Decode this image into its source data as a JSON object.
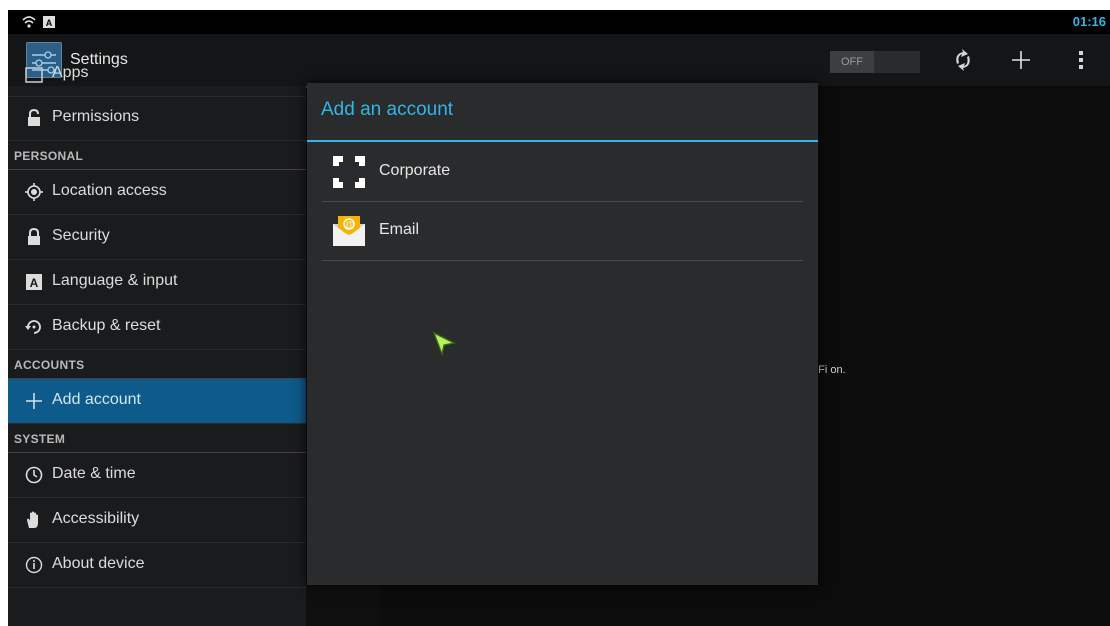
{
  "status_bar": {
    "time": "01:16"
  },
  "action_bar": {
    "title": "Settings",
    "toggle_label": "OFF"
  },
  "settings_list": {
    "partial_item": "Apps",
    "items": [
      {
        "label": "Permissions",
        "icon": "lock-icon"
      },
      {
        "label": "Location access",
        "icon": "location-icon"
      },
      {
        "label": "Security",
        "icon": "lock-icon"
      },
      {
        "label": "Language & input",
        "icon": "keyboard-icon"
      },
      {
        "label": "Backup & reset",
        "icon": "backup-icon"
      },
      {
        "label": "Add account",
        "icon": "plus-icon"
      },
      {
        "label": "Date & time",
        "icon": "clock-icon"
      },
      {
        "label": "Accessibility",
        "icon": "hand-icon"
      },
      {
        "label": "About device",
        "icon": "info-icon"
      }
    ],
    "headers": {
      "personal": "PERSONAL",
      "accounts": "ACCOUNTS",
      "system": "SYSTEM"
    }
  },
  "right_pane": {
    "hint_text": "i-Fi on."
  },
  "dialog": {
    "title": "Add an account",
    "options": [
      {
        "label": "Corporate",
        "icon": "corporate-icon"
      },
      {
        "label": "Email",
        "icon": "email-icon"
      }
    ]
  },
  "colors": {
    "accent": "#33b5e5",
    "selected": "#0e5a8a",
    "dialog_bg": "#2a2b2d"
  }
}
